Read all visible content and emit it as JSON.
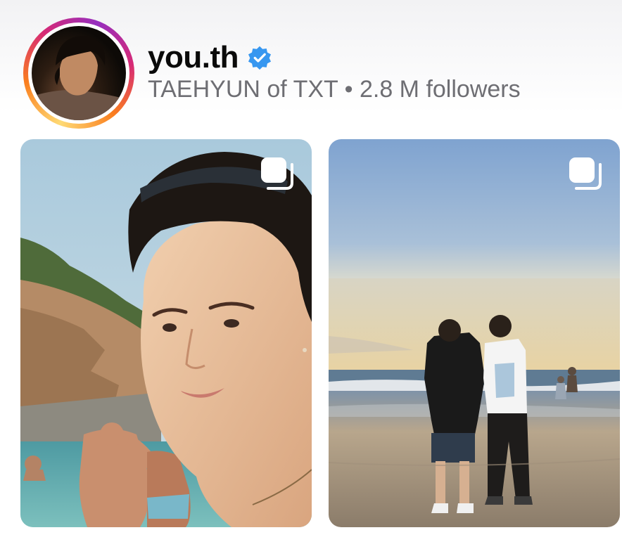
{
  "profile": {
    "username": "you.th",
    "verified": true,
    "verified_icon": "verified-badge-icon",
    "display_name": "TAEHYUN of TXT",
    "separator": "•",
    "followers": "2.8 M followers",
    "subtitle": "TAEHYUN of TXT • 2.8 M followers"
  },
  "posts": [
    {
      "type": "carousel",
      "icon": "multiple-photos-icon",
      "scene": "selfie at a rocky cove"
    },
    {
      "type": "carousel",
      "icon": "multiple-photos-icon",
      "scene": "two people on a beach at sunset"
    }
  ],
  "colors": {
    "verified": "#3797f0",
    "username": "#0a0a0a",
    "subtitle": "#6e6e73",
    "story_ring": [
      "#feda75",
      "#fa7e1e",
      "#d62976",
      "#962fbf"
    ]
  }
}
